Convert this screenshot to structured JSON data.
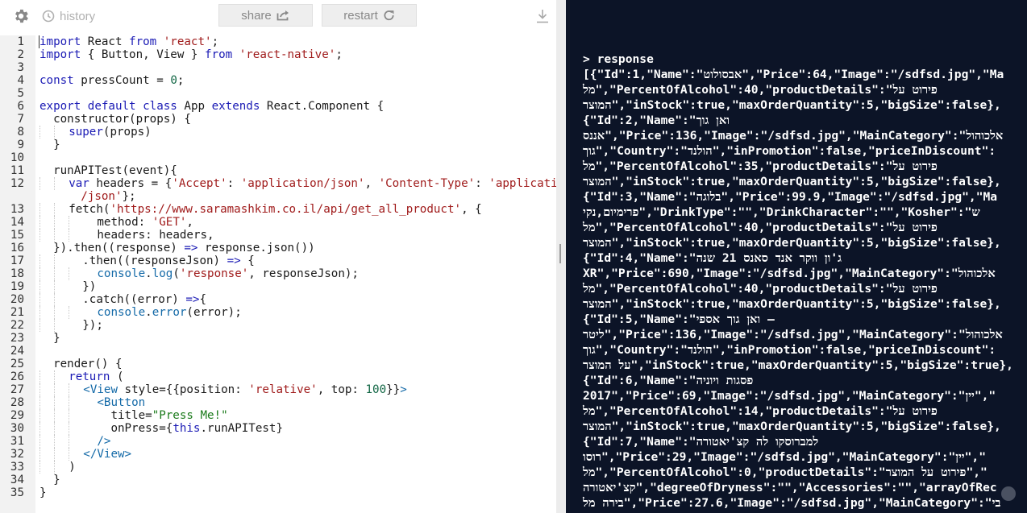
{
  "toolbar": {
    "history_label": "history",
    "share_label": "share",
    "restart_label": "restart",
    "icons": [
      "gear-icon",
      "clock-icon",
      "share-icon",
      "refresh-icon",
      "download-icon"
    ]
  },
  "editor": {
    "line_numbers": [
      "1",
      "2",
      "3",
      "4",
      "5",
      "6",
      "7",
      "8",
      "9",
      "10",
      "11",
      "12",
      "",
      "13",
      "14",
      "15",
      "16",
      "17",
      "18",
      "19",
      "20",
      "21",
      "22",
      "23",
      "24",
      "25",
      "26",
      "27",
      "28",
      "29",
      "30",
      "31",
      "32",
      "33",
      "34",
      "35"
    ],
    "code": {
      "l1a": "import",
      "l1b": " React ",
      "l1c": "from",
      "l1d": " ",
      "l1e": "'react'",
      "l1f": ";",
      "l2a": "import",
      "l2b": " { Button, View } ",
      "l2c": "from",
      "l2d": " ",
      "l2e": "'react-native'",
      "l2f": ";",
      "l4a": "const",
      "l4b": " pressCount = ",
      "l4c": "0",
      "l4d": ";",
      "l6a": "export",
      "l6b": " ",
      "l6c": "default",
      "l6d": " ",
      "l6e": "class",
      "l6f": " App ",
      "l6g": "extends",
      "l6h": " React.Component {",
      "l7": "  constructor(props) {",
      "l8a": "super",
      "l8b": "(props)",
      "l9": "  }",
      "l11": "  runAPITest(event){",
      "l12a": "var",
      "l12b": " headers = {",
      "l12c": "'Accept'",
      "l12d": ": ",
      "l12e": "'application/json'",
      "l12f": ", ",
      "l12g": "'Content-Type'",
      "l12h": ": ",
      "l12i": "'applicatio",
      "l12w": "/json'",
      "l12x": "};",
      "l13a": "fetch(",
      "l13b": "'https://www.saramashkim.co.il/api/get_all_product'",
      "l13c": ", {",
      "l14a": "method: ",
      "l14b": "'GET'",
      "l14c": ",",
      "l15": "headers: headers,",
      "l16a": "  }).then((response) ",
      "l16b": "=>",
      "l16c": " response.json())",
      "l17a": ".then((responseJson) ",
      "l17b": "=>",
      "l17c": " {",
      "l18a": "console",
      "l18b": ".",
      "l18c": "log",
      "l18d": "(",
      "l18e": "'response'",
      "l18f": ", responseJson);",
      "l19": "})",
      "l20a": ".catch((error) ",
      "l20b": "=>",
      "l20c": "{",
      "l21a": "console",
      "l21b": ".",
      "l21c": "error",
      "l21d": "(error);",
      "l22": "});",
      "l23": "  }",
      "l25": "  render() {",
      "l26a": "return",
      "l26b": " (",
      "l27a": "<View",
      "l27b": " style={{position: ",
      "l27c": "'relative'",
      "l27d": ", top: ",
      "l27e": "100",
      "l27f": "}}",
      "l27g": ">",
      "l28": "<Button",
      "l29a": "title=",
      "l29b": "\"Press Me!\"",
      "l30a": "onPress={",
      "l30b": "this",
      "l30c": ".runAPITest}",
      "l31": "/>",
      "l32": "</View>",
      "l33": ")",
      "l34": "  }",
      "l35": "}"
    }
  },
  "console": {
    "lines": [
      "> response",
      "[{\"Id\":1,\"Name\":\"אבסולוט\",\"Price\":64,\"Image\":\"/sdfsd.jpg\",\"Ma",
      "מל\",\"PercentOfAlcohol\":40,\"productDetails\":\"פירוט על",
      "המוצר\",\"inStock\":true,\"maxOrderQuantity\":5,\"bigSize\":false},",
      "{\"Id\":2,\"Name\":\"ואן גוך",
      "אננס\",\"Price\":136,\"Image\":\"/sdfsd.jpg\",\"MainCategory\":\"אלכוהול",
      "גוך\",\"Country\":\"הולנד\",\"inPromotion\":false,\"priceInDiscount\":",
      "מל\",\"PercentOfAlcohol\":35,\"productDetails\":\"פירוט על",
      "המוצר\",\"inStock\":true,\"maxOrderQuantity\":5,\"bigSize\":false},",
      "{\"Id\":3,\"Name\":\"בלוגה\",\"Price\":99.9,\"Image\":\"/sdfsd.jpg\",\"Ma",
      "פרימיום,נקי\",\"DrinkType\":\"\",\"DrinkCharacter\":\"\",\"Kosher\":\"ש",
      "מל\",\"PercentOfAlcohol\":40,\"productDetails\":\"פירוט על",
      "המוצר\",\"inStock\":true,\"maxOrderQuantity\":5,\"bigSize\":false},",
      "{\"Id\":4,\"Name\":\"ג'ון ווקר אנד סאנס 21 שנה",
      "XR\",\"Price\":690,\"Image\":\"/sdfsd.jpg\",\"MainCategory\":\"אלכוהול",
      "מל\",\"PercentOfAlcohol\":40,\"productDetails\":\"פירוט על",
      "המוצר\",\"inStock\":true,\"maxOrderQuantity\":5,\"bigSize\":false},",
      "{\"Id\":5,\"Name\":\"ואן גוך אספי –",
      "ליטר\",\"Price\":136,\"Image\":\"/sdfsd.jpg\",\"MainCategory\":\"אלכוהול",
      "גוך\",\"Country\":\"הולנד\",\"inPromotion\":false,\"priceInDiscount\":",
      "על המוצר\",\"inStock\":true,\"maxOrderQuantity\":5,\"bigSize\":true},",
      "{\"Id\":6,\"Name\":\"פסגות ויוניה",
      "2017\",\"Price\":69,\"Image\":\"/sdfsd.jpg\",\"MainCategory\":\"יין\",\"",
      "מל\",\"PercentOfAlcohol\":14,\"productDetails\":\"פירוט על",
      "המוצר\",\"inStock\":true,\"maxOrderQuantity\":5,\"bigSize\":false},",
      "{\"Id\":7,\"Name\":\"למברוסקו לה קצ'יאטורה",
      "רוסו\",\"Price\":29,\"Image\":\"/sdfsd.jpg\",\"MainCategory\":\"יין\",\"",
      "מל\",\"PercentOfAlcohol\":0,\"productDetails\":\"פירוט על המוצר\",\"",
      "קצ'יאטורה\",\"degreeOfDryness\":\"\",\"Accessories\":\"\",\"arrayOfRec",
      "בירה מל\",\"Price\":27.6,\"Image\":\"/sdfsd.jpg\",\"MainCategory\":\"בי"
    ]
  }
}
